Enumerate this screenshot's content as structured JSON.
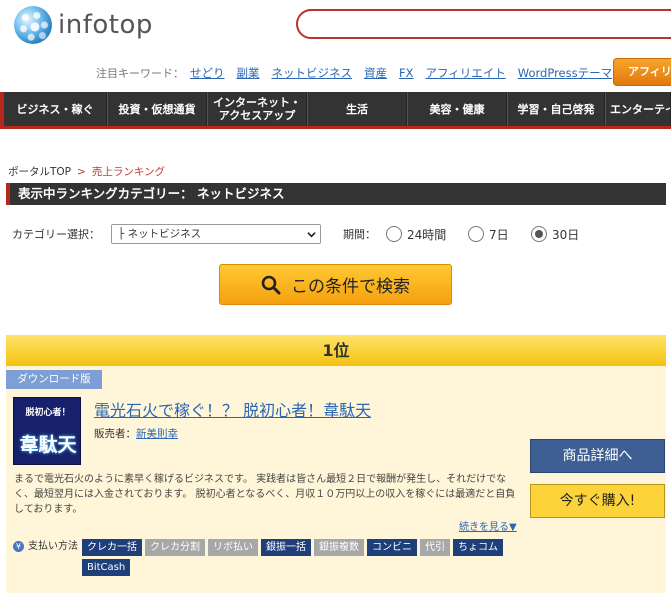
{
  "header": {
    "logo_text": "infotop",
    "search": {
      "value": "",
      "placeholder": ""
    },
    "keywords_label": "注目キーワード：",
    "keywords": [
      "せどり",
      "副業",
      "ネットビジネス",
      "資産",
      "FX",
      "アフィリエイト",
      "WordPressテーマ"
    ],
    "affiliate_button": "アフィリエ"
  },
  "nav": {
    "items": [
      {
        "label": "ビジネス・稼ぐ"
      },
      {
        "label": "投資・仮想通貨"
      },
      {
        "label": "インターネット・\nアクセスアップ"
      },
      {
        "label": "生活"
      },
      {
        "label": "美容・健康"
      },
      {
        "label": "学習・自己啓発"
      },
      {
        "label": "エンターテイ"
      }
    ]
  },
  "breadcrumb": {
    "home": "ポータルTOP",
    "separator": ">",
    "current": "売上ランキング"
  },
  "category_title": "表示中ランキングカテゴリー： ネットビジネス",
  "filters": {
    "category_label": "カテゴリー選択：",
    "category_value": "├ ネットビジネス",
    "period_label": "期間：",
    "periods": [
      {
        "label": "24時間",
        "selected": false
      },
      {
        "label": "7日",
        "selected": false
      },
      {
        "label": "30日",
        "selected": true
      }
    ],
    "search_button": "この条件で検索"
  },
  "ranking": {
    "rank_label": "1位",
    "type_tag": "ダウンロード版",
    "thumb_line1": "脱初心者！",
    "thumb_line2": "韋駄天",
    "title": "電光石火で稼ぐ！？ 脱初心者！韋駄天",
    "seller_label": "販売者：",
    "seller_name": "新美則幸",
    "description": "まるで電光石火のように素早く稼げるビジネスです。 実践者は皆さん最短２日で報酬が発生し、それだけでなく、最短翌月には入金されております。 脱初心者となるべく、月収１０万円以上の収入を稼ぐには最適だと自負しております。",
    "more_link": "続きを見る▼",
    "detail_button": "商品詳細へ",
    "buy_button": "今すぐ購入!",
    "payment_label": "支払い方法",
    "payment_icon": "¥",
    "payments": [
      {
        "label": "クレカ一括",
        "available": true
      },
      {
        "label": "クレカ分割",
        "available": false
      },
      {
        "label": "リボ払い",
        "available": false
      },
      {
        "label": "銀振一括",
        "available": true
      },
      {
        "label": "銀振複数",
        "available": false
      },
      {
        "label": "コンビニ",
        "available": true
      },
      {
        "label": "代引",
        "available": false
      },
      {
        "label": "ちょコム",
        "available": true
      },
      {
        "label": "BitCash",
        "available": true
      }
    ]
  },
  "colors": {
    "accent_red": "#b4281e",
    "nav_bg": "#333333",
    "link_blue": "#2a66b3",
    "rank_yellow": "#f4c20d",
    "card_bg": "#fff5d9",
    "detail_button": "#3d5f94",
    "buy_button": "#fcd43a",
    "tag_on": "#1f3f7a",
    "tag_off": "#a7a7a7"
  }
}
